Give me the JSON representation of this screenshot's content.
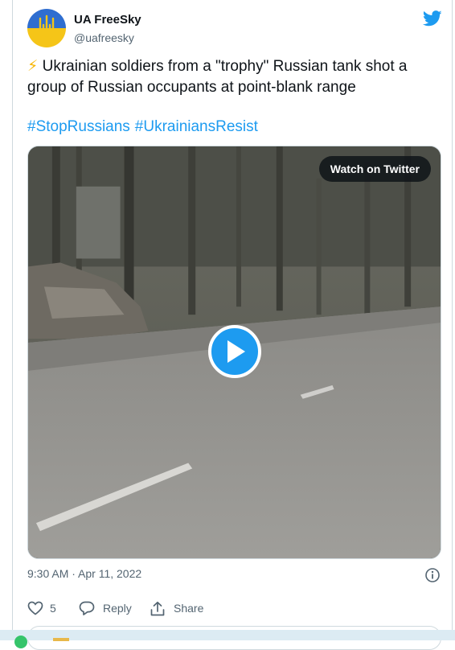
{
  "author": {
    "name": "UA FreeSky",
    "handle": "@uafreesky",
    "avatar_colors": {
      "top": "#2f6ed0",
      "bottom": "#f5c518"
    }
  },
  "tweet": {
    "bolt": "⚡",
    "text": "Ukrainian soldiers from a \"trophy\" Russian tank shot a group of Russian occupants at point-blank range",
    "hashtags": [
      "#StopRussians",
      "#UkrainiansResist"
    ]
  },
  "media": {
    "watch_label": "Watch on Twitter",
    "play_icon": "play-icon"
  },
  "meta": {
    "timestamp": "9:30 AM · Apr 11, 2022"
  },
  "actions": {
    "likes_count": "5",
    "reply_label": "Reply",
    "share_label": "Share"
  },
  "colors": {
    "accent": "#1d9bf0",
    "text": "#0f1419",
    "muted": "#536471"
  }
}
